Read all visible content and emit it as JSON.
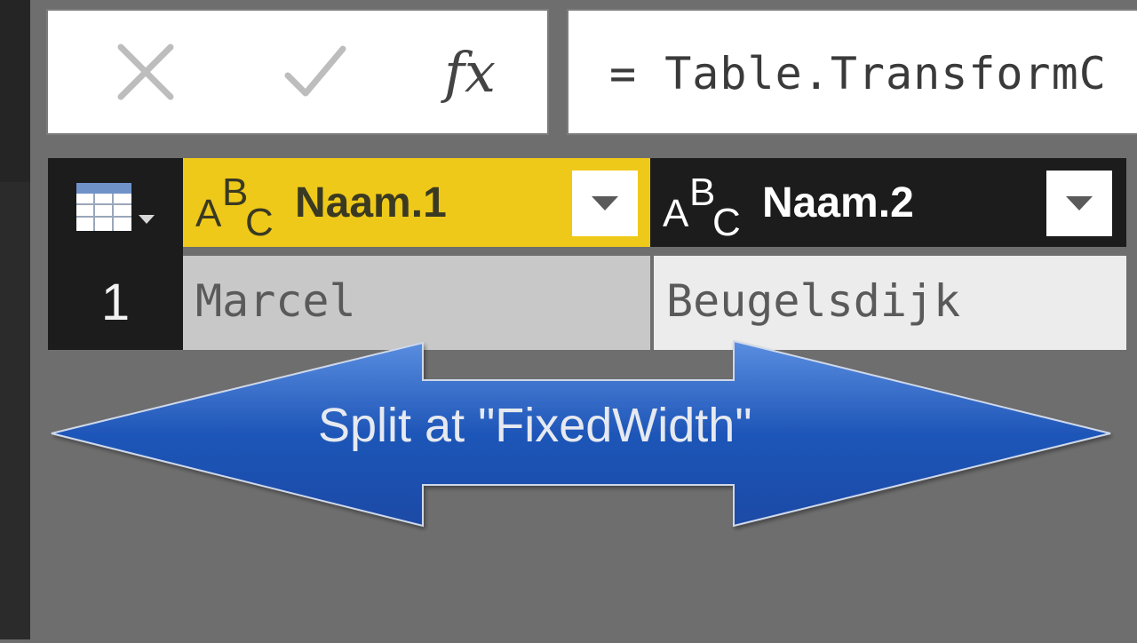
{
  "formula_bar": {
    "cancel_icon": "close-icon",
    "confirm_icon": "check-icon",
    "fx_label": "fx",
    "formula_text": "= Table.TransformC"
  },
  "grid": {
    "table_icon": "table-menu-icon",
    "columns": [
      {
        "type_label": "ABC",
        "name": "Naam.1",
        "selected": true,
        "accent": "#efc919"
      },
      {
        "type_label": "ABC",
        "name": "Naam.2",
        "selected": false
      }
    ],
    "rows": [
      {
        "row_number": "1",
        "cells": [
          "Marcel",
          "Beugelsdijk"
        ]
      }
    ]
  },
  "annotation": {
    "label": "Split at \"FixedWidth\"",
    "color": "#2a5bb8"
  }
}
